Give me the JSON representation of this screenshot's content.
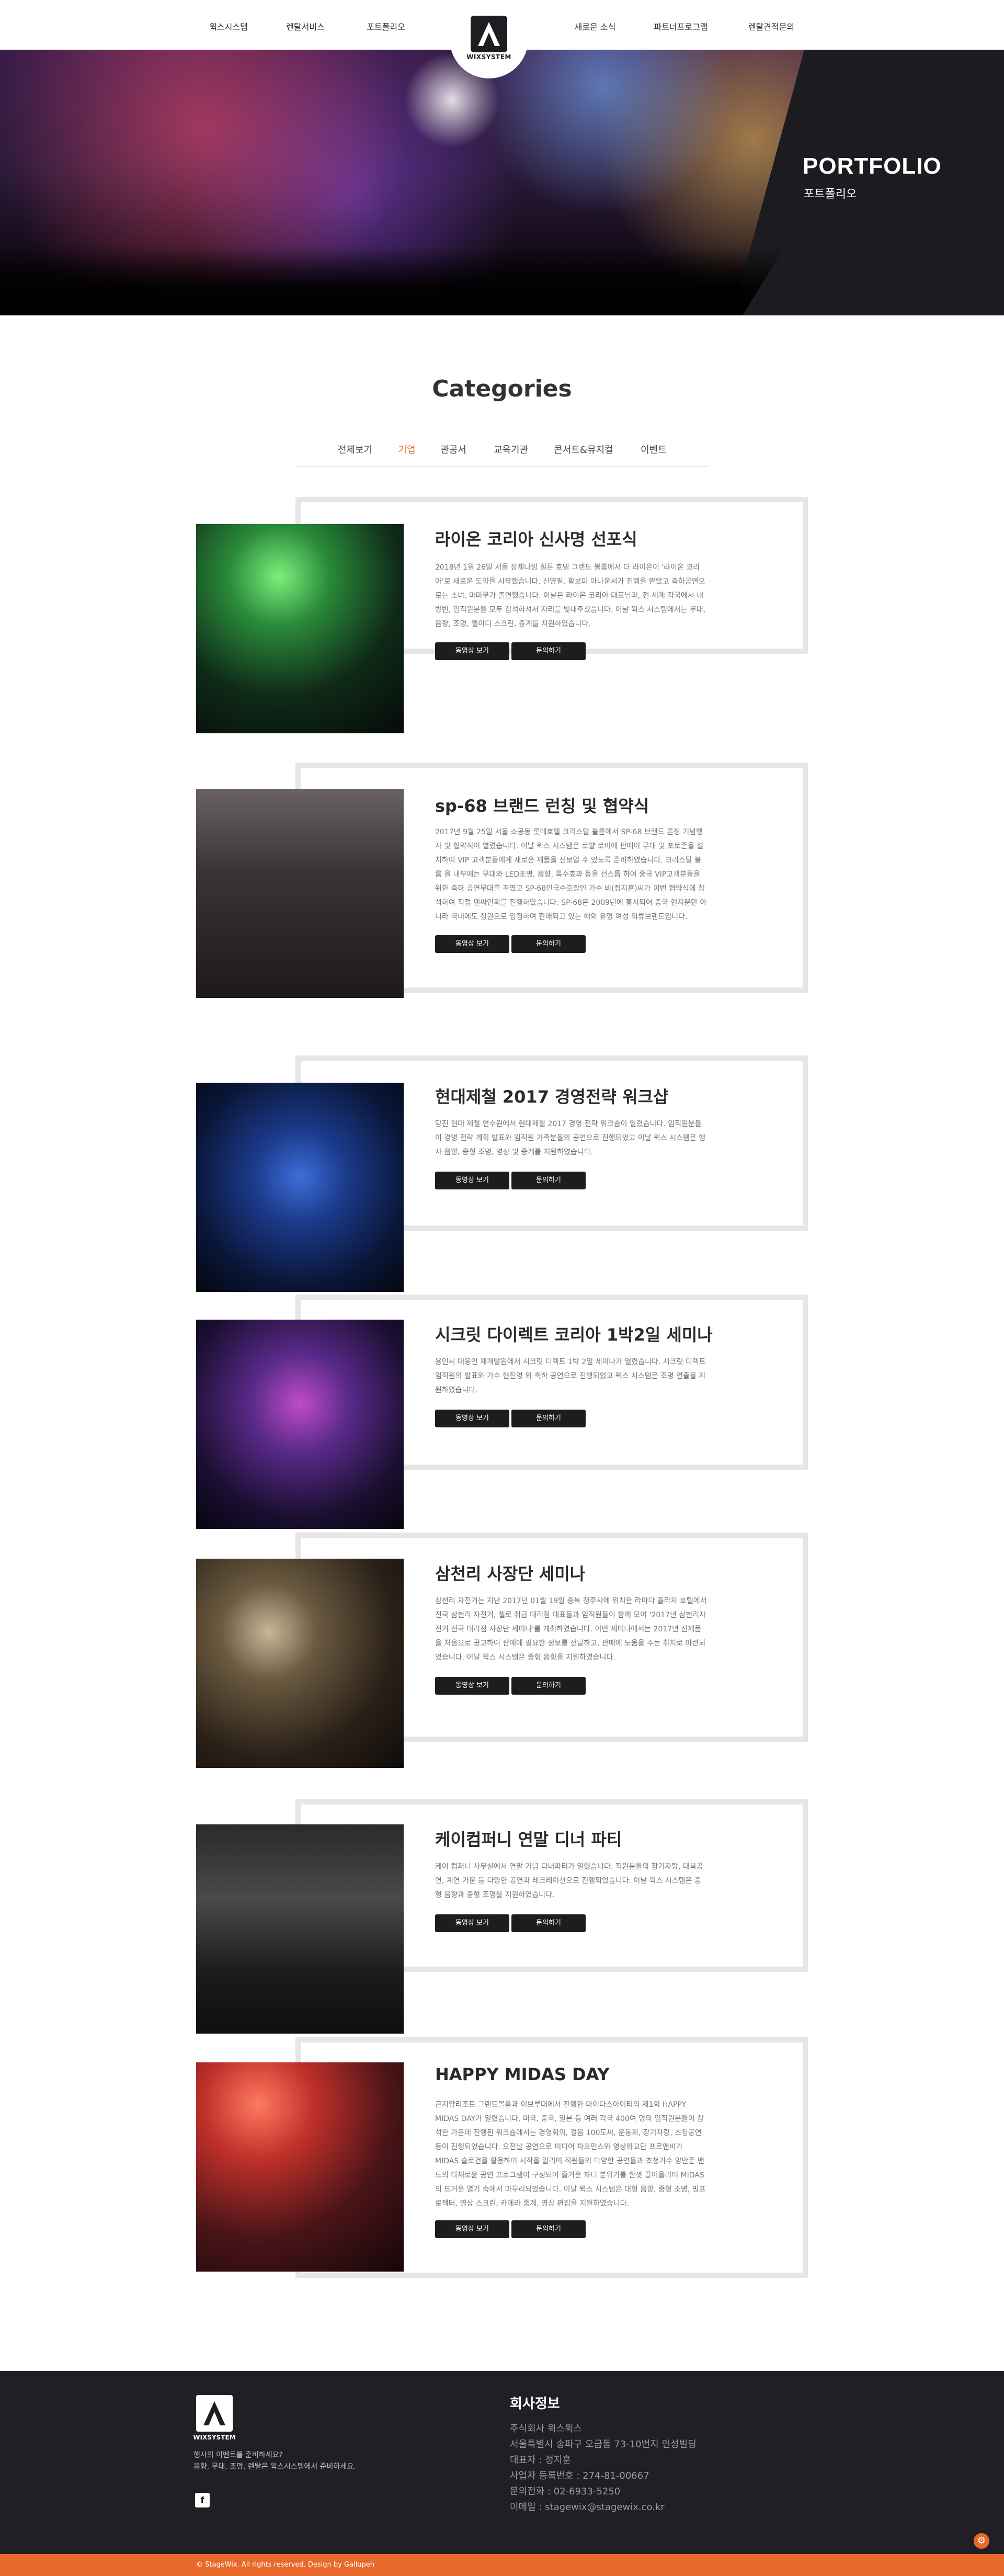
{
  "nav": {
    "left_items": [
      "윅스시스템",
      "렌탈서비스",
      "포트폴리오"
    ],
    "right_items": [
      "새로운 소식",
      "파트너프로그램",
      "렌탈견적문의"
    ],
    "logo_text": "WIXSYSTEM"
  },
  "hero": {
    "title": "PORTFOLIO",
    "subtitle": "포트폴리오"
  },
  "categories": {
    "title": "Categories",
    "tabs": [
      "전체보기",
      "기업",
      "관공서",
      "교육기관",
      "콘서트&뮤지컬",
      "이벤트"
    ],
    "active_tab": "기업"
  },
  "items": [
    {
      "title": "라이온 코리아 신사명 선포식",
      "desc": "2018년 1월 26일 서울 잠제나잉 힐튼 호텔 그랜드 볼룸에서 더 라이온이 '라이온 코리아'로 새로운 도약을 시작했습니다. 신영필, 황보미 아나운서가 진행을 맡았고 축하공연으로는 소녀, 마마무가 출연했습니다. 이날은 라이온 코리아 대표님과, 전 세계 각국에서 내방빈, 임직원분들 모두 참석하셔서 자리를 빛내주셨습니다. 이날 윅스 시스템에서는 무대, 음향, 조명, 엘이디 스크린, 중계를 지원하였습니다.",
      "buttons": [
        "동영상 보기",
        "문의하기"
      ]
    },
    {
      "title": "sp-68 브랜드 런칭 및 협약식",
      "desc": "2017년 9월 25일 서울 소공동 롯데호텔 크리스탈 볼룸에서 SP-68 브랜드 론칭 기념행사 및 협약식이 열렸습니다. 이날 윅스 시스템은 로얄 로비에 판매이 무대 및 포토존을 설치하여 VIP 고객분들에게 새로운 제품을 선보일 수 있도록 준비하였습니다. 크리스탈 볼룸 을 내부에는 무대와 LED조명, 음향, 특수효과 등을 선스톱 하여 중국 VIP고객분들을 위한 축하 공연무대를 꾸몄고 SP-68인국수호랑인 가수 비(정지훈)씨가 이번 협약식에 참석하여 직접 팬싸인회를 진행하였습니다. SP-68은 2009년에 홍시되어 중국 현지뿐만 아니라 국내에도 청원으로 입점하여 판매되고 있는 해외 유명 여성 의류브랜드입니다.",
      "buttons": [
        "동영상 보기",
        "문의하기"
      ]
    },
    {
      "title": "현대제철 2017 경영전략 워크샵",
      "desc": "당진 현대 제철 연수원에서 현대제철 2017 경영 전략 워크숍이 열렸습니다. 임직원분들이 경영 전략 계획 발표와 임직원 가족분들의 공연으로 진행되었고 이날 윅스 시스템은 행사 음향, 중형 조명, 영상 및 중계를 지원하였습니다.",
      "buttons": [
        "동영상 보기",
        "문의하기"
      ]
    },
    {
      "title": "시크릿 다이렉트 코리아 1박2일 세미나",
      "desc": "용인시 대웅인 재개발원에서 시크릿 디렉트 1박 2일 세미나가 열렸습니다. 시크릿 디렉트 임직원의 발표와 가수 현진영 외 축하 공연으로 진행되었고 윅스 시스템은 조명 연출을 지원하였습니다.",
      "buttons": [
        "동영상 보기",
        "문의하기"
      ]
    },
    {
      "title": "삼천리 사장단 세미나",
      "desc": "삼천리 자전거는 지난 2017년 01월 19일 충북 청주시에 위치한 라마다 플라자 호텔에서 전국 삼천리 자전거, 첼로 취급 대리점 대표들과 임직원들이 함께 모여 '2017년 삼천리자전거 전국 대리점 사장단 세미나'를 개최하였습니다. 이번 세미나에서는 2017년 신제품을 처음으로 공고하여 판매에 필요한 정보를 전달하고, 판매에 도움을 주는 취지로 마련되었습니다. 이날 윅스 시스템은 중형 음향을 지원하였습니다.",
      "buttons": [
        "동영상 보기",
        "문의하기"
      ]
    },
    {
      "title": "케이컴퍼니 연말 디너 파티",
      "desc": "케이 컴퍼니 사무실에서 연말 기념 디너파티가 열렸습니다. 직원분들의 장기자랑, 대북공연, 계연 가문 등 다양한 공연과 레크레이션으로 진행되었습니다. 이날 윅스 시스템은 중형 음향과 중형 조명을 지원하였습니다.",
      "buttons": [
        "동영상 보기",
        "문의하기"
      ]
    },
    {
      "title": "HAPPY MIDAS DAY",
      "desc": "곤지암리조트 그랜드볼룸과 이브루대에서 진행한 마이다스아이티의 제1회 HAPPY MIDAS DAY가 열렸습니다. 미국, 중국, 일본 등 여러 각국 400여 명의 임직원분들이 참석한 가운데 진행된 워크숍에서는 경영회의, 걸음 100도씨, 운동회, 장기자랑, 초청공연 등이 진행되었습니다. 오전날 공연으로 미디어 파포먼스와 영상화교단 프로앤비가 MIDAS 슬로건을 활용하여 시작을 알리며 직원들의 다양한 공연들과 초청가수 양만준 밴드의 다채로운 공연 프로그램이 구성되어 즐거운 파티 분위기를 한껏 끌어올리며 MIDAS 의 뜨거운 열기 속에서 마무리되었습니다. 이날 윅스 시스템은 대형 음향, 중형 조명, 빔프로젝터, 영상 스크린, 카메라 중계, 영상 편집을 지원하였습니다.",
      "buttons": [
        "동영상 보기",
        "문의하기"
      ]
    }
  ],
  "footer": {
    "logo_text": "WIXSYSTEM",
    "tagline1": "행사의 이벤트를 준비하세요?",
    "tagline2": "음향, 무대, 조명, 렌탈은 윅스시스템에서 준비하세요.",
    "social_icon": "facebook-icon",
    "info_title": "회사정보",
    "info_lines": [
      "주식회사 윅스윅스",
      "서울특별시 송파구 오금동 73-10번지 인성빌딩",
      "대표자 : 정지훈",
      "사업자 등록번호 : 274-81-00667",
      "문의전화 : 02-6933-5250",
      "이메일 : stagewix@stagewix.co.kr"
    ],
    "copyright": "© StageWix. All rights reserved. Design by Gallupeh"
  },
  "colors": {
    "accent": "#e8682a",
    "dark": "#1e1e22",
    "frame": "#e6e6e6"
  }
}
